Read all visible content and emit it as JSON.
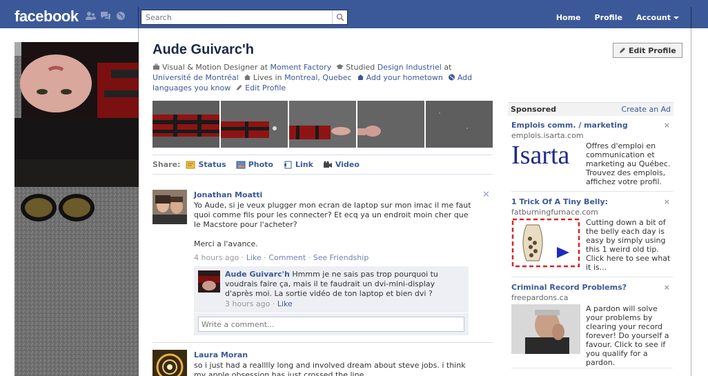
{
  "topbar": {
    "logo": "facebook",
    "search_placeholder": "Search",
    "nav": {
      "home": "Home",
      "profile": "Profile",
      "account": "Account"
    }
  },
  "profile": {
    "name": "Aude Guivarc'h",
    "edit_button": "Edit Profile",
    "info": {
      "job_title": "Visual & Motion Designer at",
      "job_company": "Moment Factory",
      "studied_prefix": "Studied",
      "studied_field": "Design Industriel",
      "studied_at": "at",
      "school": "Université de Montréal",
      "lives_prefix": "Lives in",
      "city": "Montreal, Quebec",
      "add_hometown": "Add your hometown",
      "add_languages": "Add languages you know",
      "edit_profile_link": "Edit Profile"
    }
  },
  "share": {
    "label": "Share:",
    "items": [
      {
        "label": "Status",
        "icon": "status-icon"
      },
      {
        "label": "Photo",
        "icon": "photo-icon"
      },
      {
        "label": "Link",
        "icon": "link-icon"
      },
      {
        "label": "Video",
        "icon": "video-icon"
      }
    ]
  },
  "feed": {
    "story1": {
      "author": "Jonathan Moatti",
      "text": "Yo Aude, si je veux plugger mon ecran de laptop sur mon imac il me faut quoi comme fils pour les connecter? Et ecq ya un endroit moin cher que le Macstore pour l'acheter?\n\nMerci a l'avance.",
      "time": "4 hours ago",
      "like": "Like",
      "comment": "Comment",
      "see_friendship": "See Friendship",
      "reply": {
        "author": "Aude Guivarc'h",
        "text": "Hmmm je ne sais pas trop pourquoi tu voudrais faire ça, mais il te faudrait un dvi-mini-display d'après moi. La sortie vidéo de ton laptop et bien dvi ?",
        "time": "3 hours ago",
        "like": "Like"
      },
      "comment_placeholder": "Write a comment..."
    },
    "story2": {
      "author": "Laura Moran",
      "text": "so i just had a realllly long and involved dream about steve jobs. i think my apple obsession has just crossed the line."
    }
  },
  "sidebar": {
    "sponsored": "Sponsored",
    "create_ad": "Create an Ad",
    "ads": [
      {
        "title": "Emplois comm. / marketing",
        "domain": "emplois.isarta.com",
        "logo_text": "Isarta",
        "text": "Offres d'emploi en communication et marketing au Québec. Trouvez des emplois, affichez votre profil."
      },
      {
        "title": "1 Trick Of A Tiny Belly:",
        "domain": "fatburningfurnace.com",
        "text": "Cutting down a bit of the belly each day is easy by simply using this 1 weird old tip. Click here to see what it is..."
      },
      {
        "title": "Criminal Record Problems?",
        "domain": "freepardons.ca",
        "text": "A pardon will solve your problems by clearing your record forever! Do yourself a favour. Click to see if you qualify for a pardon."
      }
    ],
    "close_glyph": "×"
  },
  "colors": {
    "brand": "#3b5998",
    "link": "#3b5998",
    "comment_bg": "#edeff4"
  }
}
